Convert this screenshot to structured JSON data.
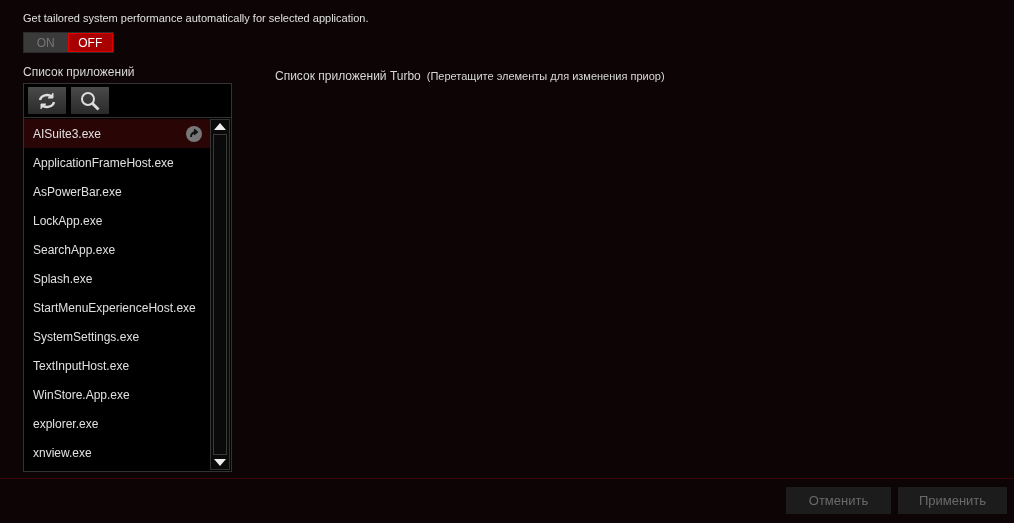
{
  "description": "Get tailored system performance automatically for selected application.",
  "toggle": [
    {
      "label": "ON",
      "selected": false
    },
    {
      "label": "OFF",
      "selected": true
    }
  ],
  "app_list": {
    "title": "Список приложений",
    "items": [
      {
        "name": "AISuite3.exe",
        "selected": true
      },
      {
        "name": "ApplicationFrameHost.exe",
        "selected": false
      },
      {
        "name": "AsPowerBar.exe",
        "selected": false
      },
      {
        "name": "LockApp.exe",
        "selected": false
      },
      {
        "name": "SearchApp.exe",
        "selected": false
      },
      {
        "name": "Splash.exe",
        "selected": false
      },
      {
        "name": "StartMenuExperienceHost.exe",
        "selected": false
      },
      {
        "name": "SystemSettings.exe",
        "selected": false
      },
      {
        "name": "TextInputHost.exe",
        "selected": false
      },
      {
        "name": "WinStore.App.exe",
        "selected": false
      },
      {
        "name": "explorer.exe",
        "selected": false
      },
      {
        "name": "xnview.exe",
        "selected": false
      }
    ]
  },
  "turbo_list": {
    "title": "Список приложений Turbo",
    "hint": "(Перетащите элементы для изменения приор)"
  },
  "buttons": [
    {
      "label": "Отменить",
      "disabled": true
    },
    {
      "label": "Применить",
      "disabled": true
    }
  ]
}
